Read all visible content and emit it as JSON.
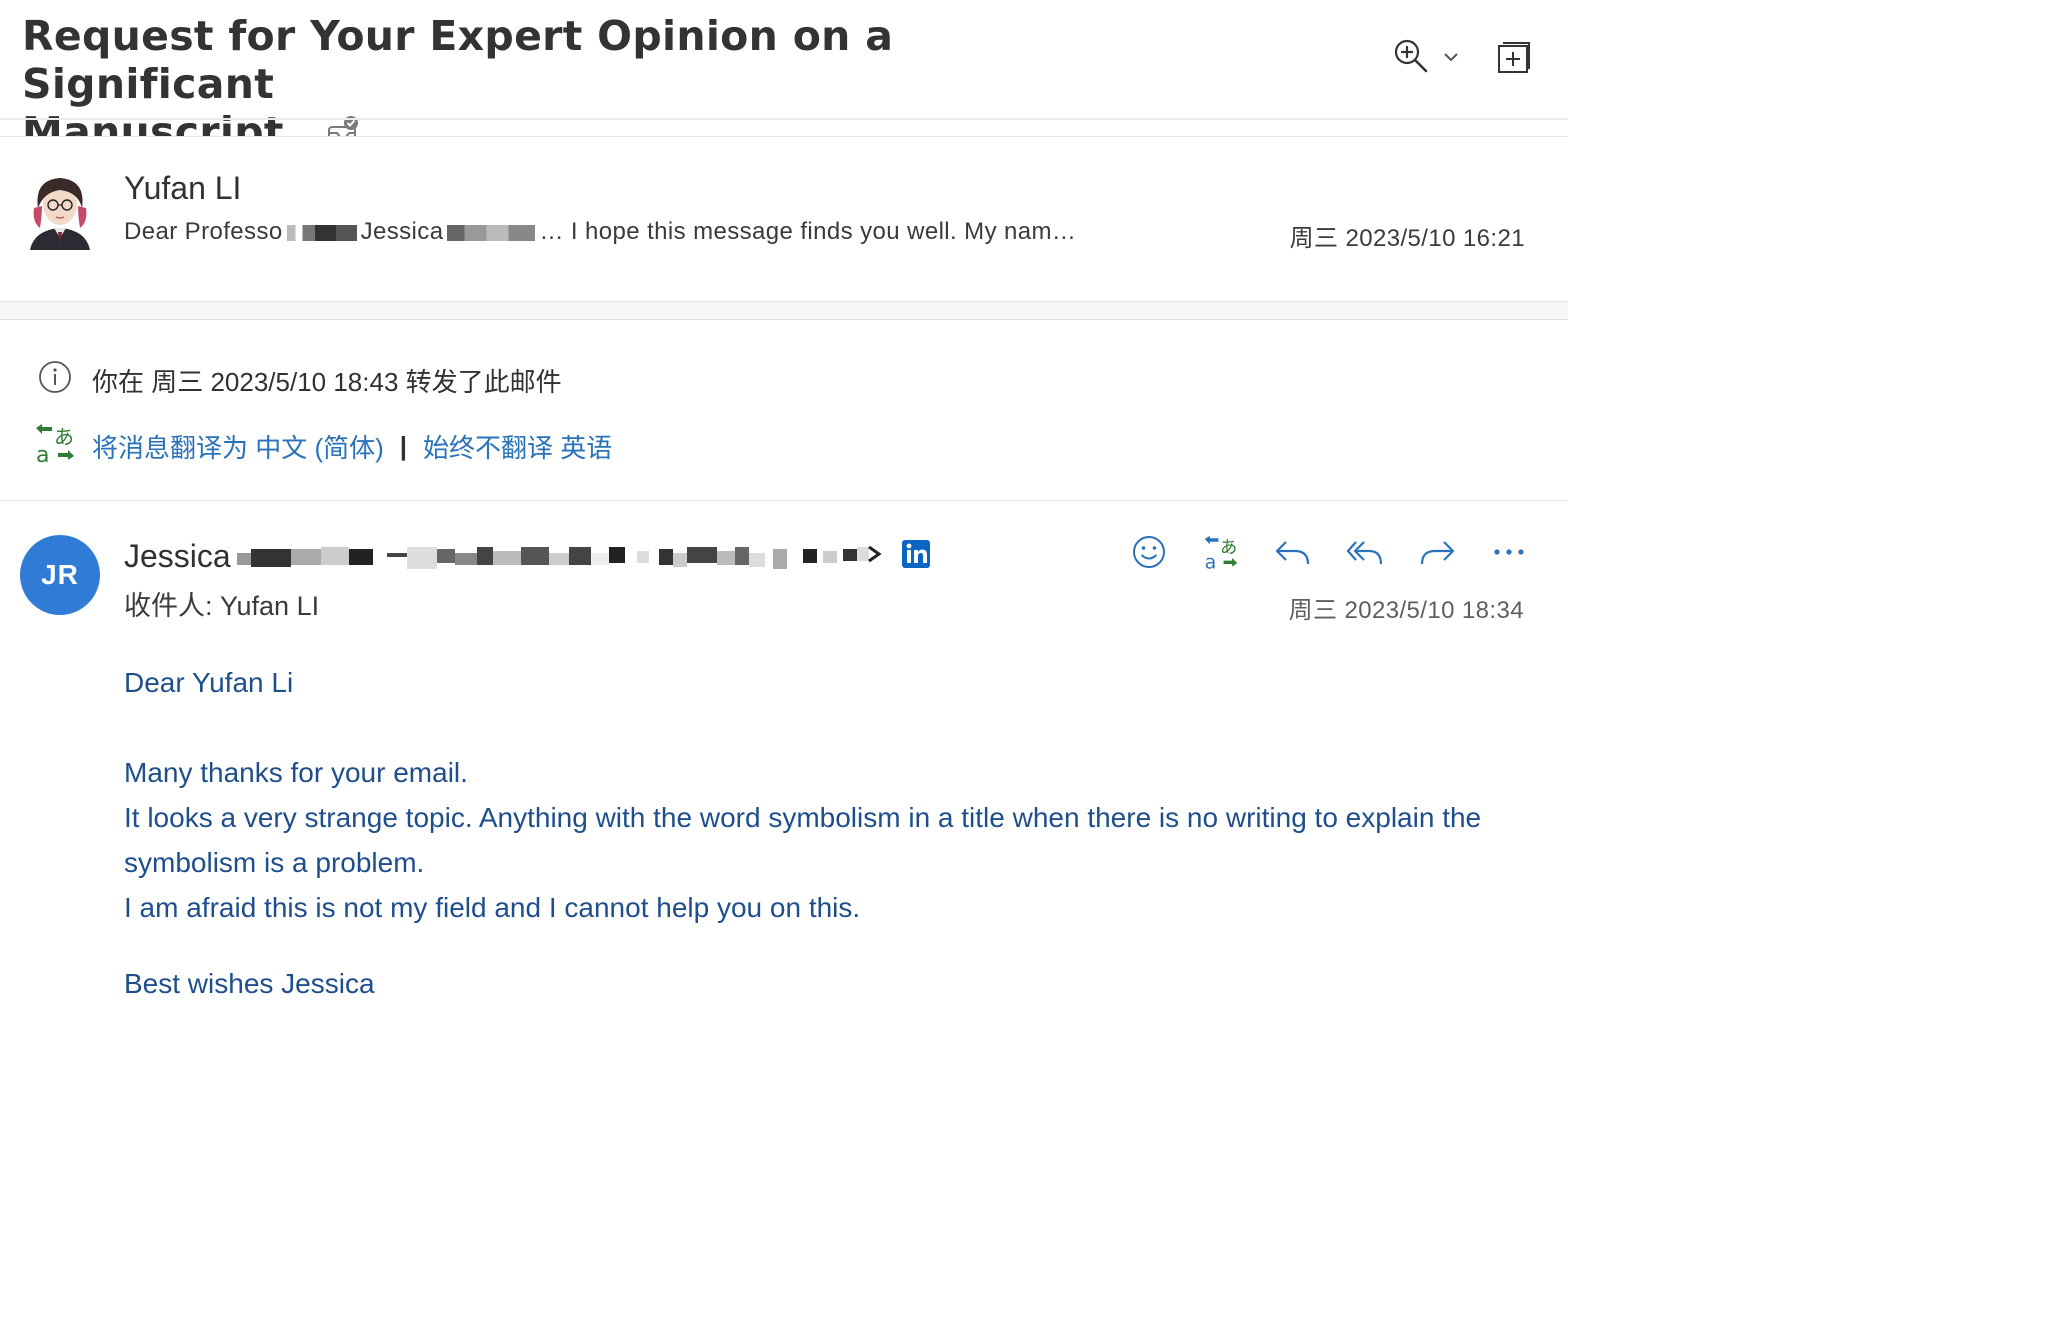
{
  "subject": {
    "title_line1": "Request for Your Expert Opinion on a Significant",
    "title_line2": "Manuscript"
  },
  "collapsed_message": {
    "sender": "Yufan LI",
    "preview_start": "Dear Professo",
    "preview_name": "Jessica",
    "preview_rest": "… I hope this message finds you well. My nam…",
    "date": "周三 2023/5/10 16:21"
  },
  "info": {
    "forward_notice": "你在 周三 2023/5/10 18:43 转发了此邮件",
    "translate_link": "将消息翻译为 中文 (简体)",
    "separator": "|",
    "never_translate_link": "始终不翻译 英语"
  },
  "open_message": {
    "avatar_initials": "JR",
    "sender_first_name": "Jessica",
    "recipient": "收件人:  Yufan LI",
    "date": "周三 2023/5/10 18:34",
    "body": {
      "greeting": "Dear Yufan Li",
      "line1": "Many thanks for your email.",
      "line2": "It looks a very strange topic. Anything with the word symbolism in a title when there is no writing to explain the symbolism is a problem.",
      "line3": "I am afraid this is not my field and I cannot help you on this.",
      "signoff": "Best wishes Jessica"
    }
  },
  "colors": {
    "accent_blue": "#2a72b9",
    "body_text": "#1e4e8c",
    "avatar_bg": "#2f7bd6",
    "translate_green": "#2e7d32",
    "linkedin_blue": "#0a66c2"
  },
  "icons": {
    "tag": "mail-check-icon",
    "zoom": "zoom-in-icon",
    "popout": "pop-out-icon",
    "info": "info-icon",
    "translate": "translate-icon",
    "linkedin": "linkedin-icon",
    "emoji": "emoji-icon",
    "reply": "reply-icon",
    "reply_all": "reply-all-icon",
    "forward": "forward-icon",
    "more": "more-icon"
  }
}
